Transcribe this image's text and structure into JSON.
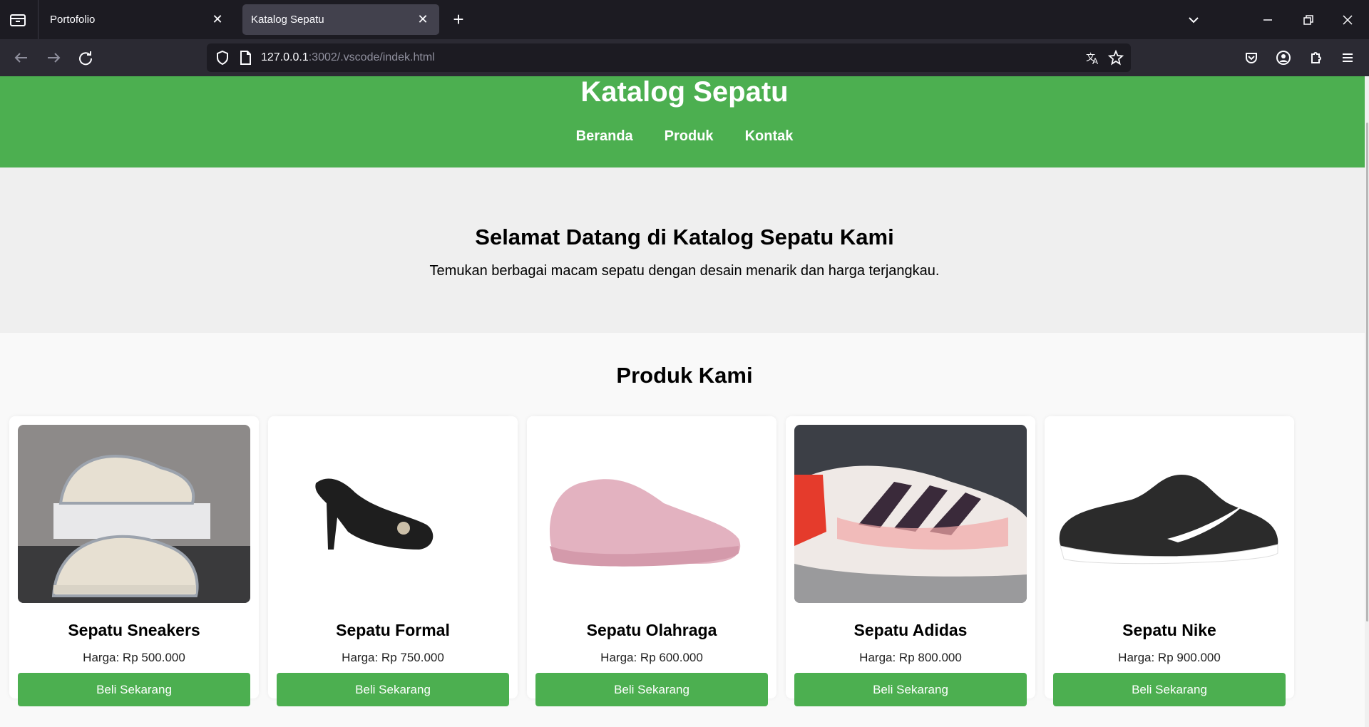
{
  "browser": {
    "tabs": [
      {
        "title": "Portofolio",
        "active": false
      },
      {
        "title": "Katalog Sepatu",
        "active": true
      }
    ],
    "url": {
      "host": "127.0.0.1",
      "path": ":3002/.vscode/indek.html"
    }
  },
  "site": {
    "title": "Katalog Sepatu",
    "nav": [
      "Beranda",
      "Produk",
      "Kontak"
    ],
    "hero": {
      "heading": "Selamat Datang di Katalog Sepatu Kami",
      "text": "Temukan berbagai macam sepatu dengan desain menarik dan harga terjangkau."
    },
    "products_title": "Produk Kami",
    "products": [
      {
        "name": "Sepatu Sneakers",
        "price": "Harga: Rp 500.000",
        "button": "Beli Sekarang"
      },
      {
        "name": "Sepatu Formal",
        "price": "Harga: Rp 750.000",
        "button": "Beli Sekarang"
      },
      {
        "name": "Sepatu Olahraga",
        "price": "Harga: Rp 600.000",
        "button": "Beli Sekarang"
      },
      {
        "name": "Sepatu Adidas",
        "price": "Harga: Rp 800.000",
        "button": "Beli Sekarang"
      },
      {
        "name": "Sepatu Nike",
        "price": "Harga: Rp 900.000",
        "button": "Beli Sekarang"
      }
    ]
  },
  "colors": {
    "brand_green": "#4caf50",
    "chrome_dark": "#1c1b22",
    "toolbar": "#2b2a33"
  }
}
